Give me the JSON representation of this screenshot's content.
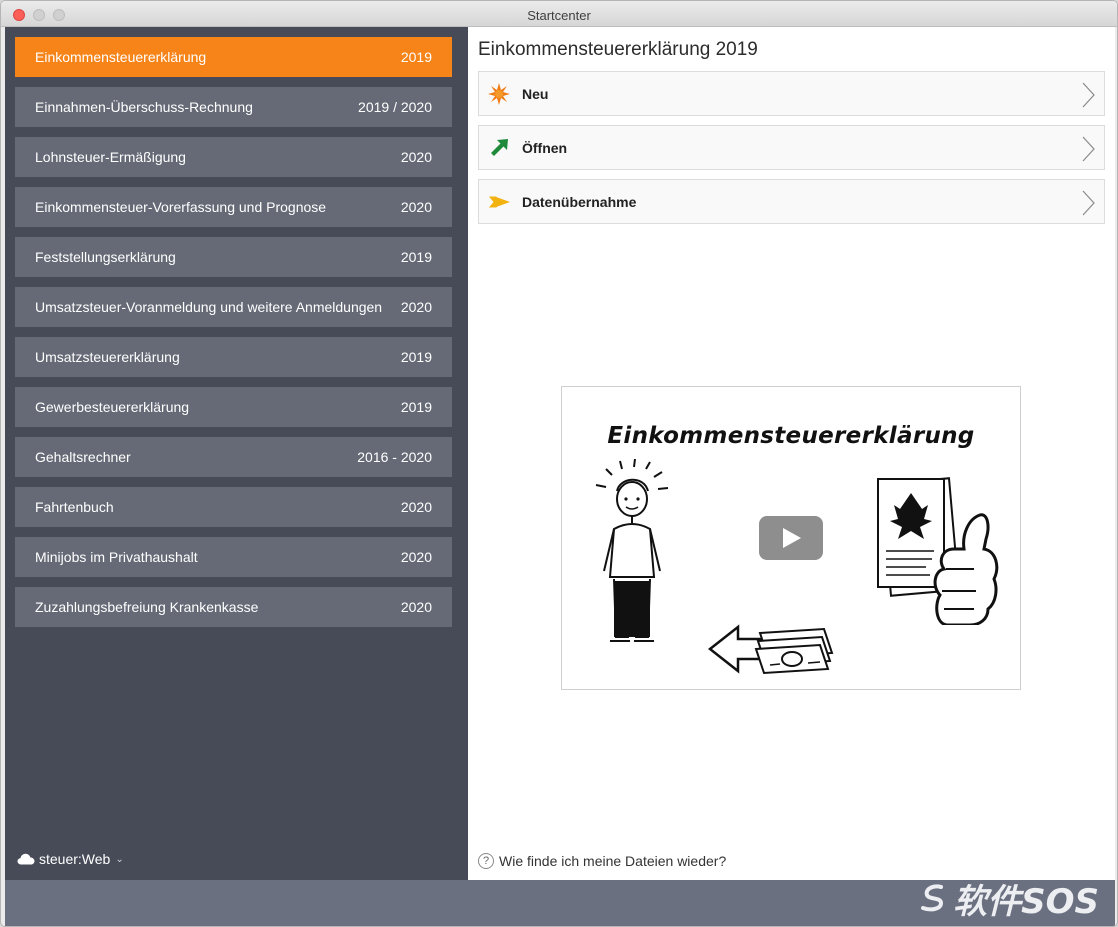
{
  "window": {
    "title": "Startcenter"
  },
  "sidebar": {
    "items": [
      {
        "label": "Einkommensteuererklärung",
        "year": "2019",
        "active": true
      },
      {
        "label": "Einnahmen-Überschuss-Rechnung",
        "year": "2019 / 2020"
      },
      {
        "label": "Lohnsteuer-Ermäßigung",
        "year": "2020"
      },
      {
        "label": "Einkommensteuer-Vorerfassung und Prognose",
        "year": "2020"
      },
      {
        "label": "Feststellungserklärung",
        "year": "2019"
      },
      {
        "label": "Umsatzsteuer-Voranmeldung und weitere Anmeldungen",
        "year": "2020"
      },
      {
        "label": "Umsatzsteuererklärung",
        "year": "2019"
      },
      {
        "label": "Gewerbesteuererklärung",
        "year": "2019"
      },
      {
        "label": "Gehaltsrechner",
        "year": "2016 - 2020"
      },
      {
        "label": "Fahrtenbuch",
        "year": "2020"
      },
      {
        "label": "Minijobs im Privathaushalt",
        "year": "2020"
      },
      {
        "label": "Zuzahlungsbefreiung Krankenkasse",
        "year": "2020"
      }
    ],
    "cloud_label": "steuer:Web"
  },
  "main": {
    "title": "Einkommensteuererklärung 2019",
    "actions": [
      {
        "label": "Neu",
        "icon": "starburst-icon"
      },
      {
        "label": "Öffnen",
        "icon": "green-arrow-icon"
      },
      {
        "label": "Datenübernahme",
        "icon": "yellow-arrow-icon"
      }
    ],
    "video": {
      "title": "Einkommensteuererklärung"
    },
    "help_text": "Wie finde ich meine Dateien wieder?"
  },
  "watermark": "软件SOS",
  "colors": {
    "accent": "#f68418",
    "sidebar_bg": "#474b57",
    "nav_item_bg": "#656a76",
    "footer_bg": "#6b7080"
  }
}
